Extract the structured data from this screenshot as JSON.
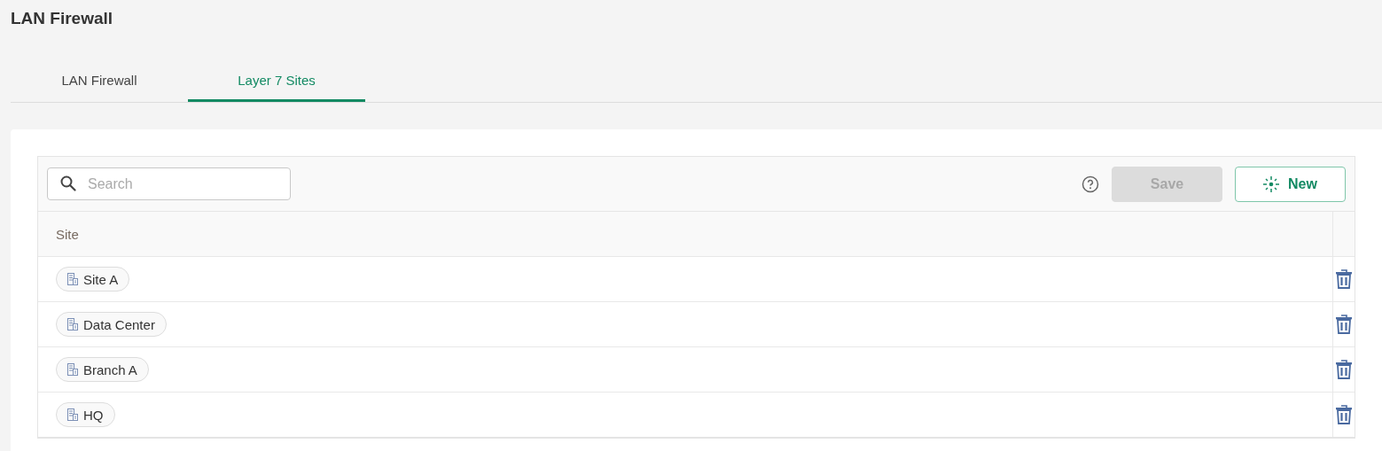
{
  "page": {
    "title": "LAN Firewall"
  },
  "tabs": [
    {
      "label": "LAN Firewall",
      "selected": false
    },
    {
      "label": "Layer 7 Sites",
      "selected": true
    }
  ],
  "toolbar": {
    "search": {
      "placeholder": "Search"
    },
    "buttons": [
      {
        "kind": "save",
        "label": "Save",
        "disabled": true
      },
      {
        "kind": "new",
        "label": "New",
        "disabled": false
      }
    ]
  },
  "table": {
    "columns": [
      "Site"
    ],
    "rows": [
      {
        "site": "Site A"
      },
      {
        "site": "Data Center"
      },
      {
        "site": "Branch A"
      },
      {
        "site": "HQ"
      }
    ]
  }
}
